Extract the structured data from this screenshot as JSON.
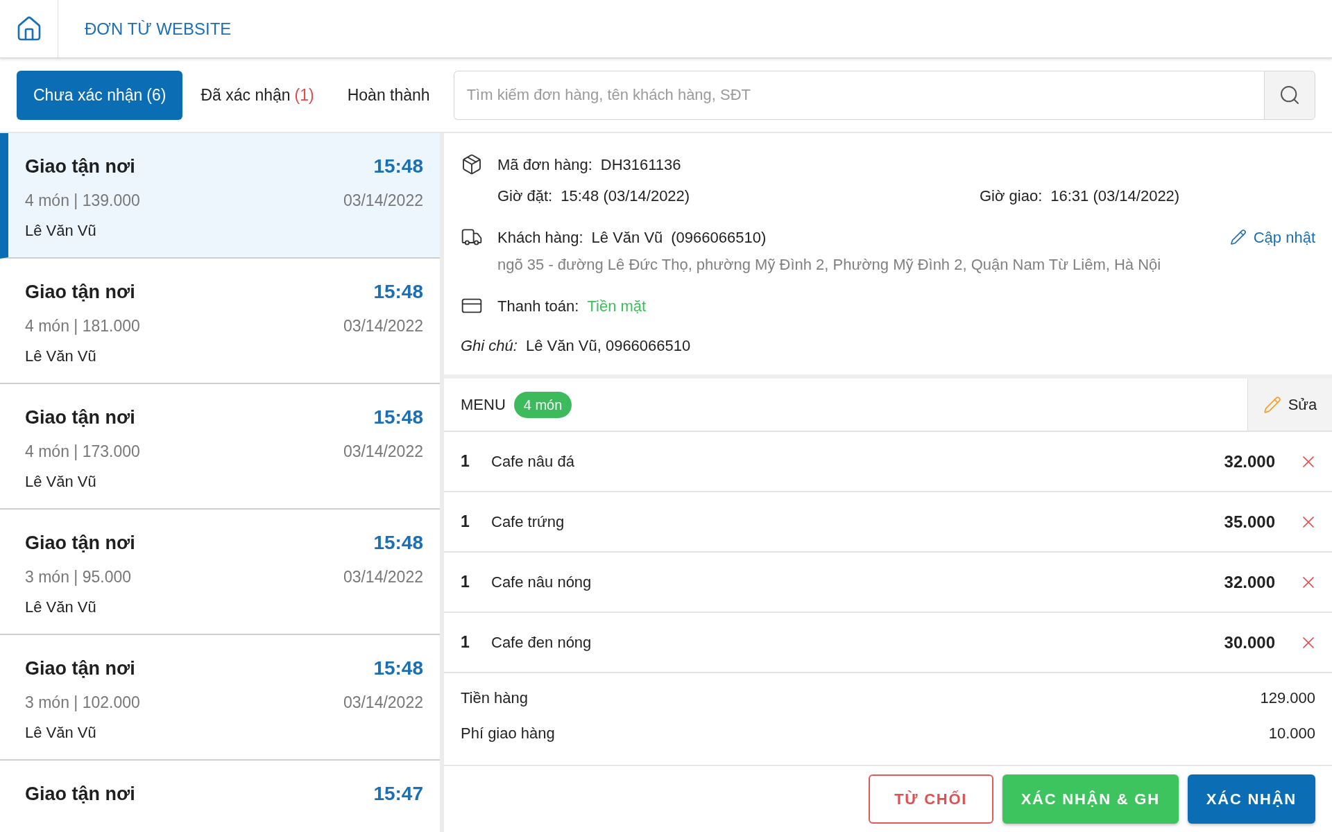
{
  "header": {
    "title": "ĐƠN TỪ WEBSITE"
  },
  "tabs": [
    {
      "label": "Chưa xác nhận",
      "count": "(6)",
      "selected": true
    },
    {
      "label": "Đã xác nhận",
      "count": "(1)",
      "selected": false
    },
    {
      "label": "Hoàn thành",
      "selected": false
    }
  ],
  "search": {
    "placeholder": "Tìm kiếm đơn hàng, tên khách hàng, SĐT"
  },
  "orders": [
    {
      "title": "Giao tận nơi",
      "time": "15:48",
      "summary": "4 món | 139.000",
      "date": "03/14/2022",
      "customer": "Lê Văn Vũ",
      "selected": true
    },
    {
      "title": "Giao tận nơi",
      "time": "15:48",
      "summary": "4 món | 181.000",
      "date": "03/14/2022",
      "customer": "Lê Văn Vũ",
      "selected": false
    },
    {
      "title": "Giao tận nơi",
      "time": "15:48",
      "summary": "4 món | 173.000",
      "date": "03/14/2022",
      "customer": "Lê Văn Vũ",
      "selected": false
    },
    {
      "title": "Giao tận nơi",
      "time": "15:48",
      "summary": "3 món | 95.000",
      "date": "03/14/2022",
      "customer": "Lê Văn Vũ",
      "selected": false
    },
    {
      "title": "Giao tận nơi",
      "time": "15:48",
      "summary": "3 món | 102.000",
      "date": "03/14/2022",
      "customer": "Lê Văn Vũ",
      "selected": false
    },
    {
      "title": "Giao tận nơi",
      "time": "15:47",
      "selected": false
    }
  ],
  "detail": {
    "order_code": {
      "label": "Mã đơn hàng:",
      "value": "DH3161136"
    },
    "order_time": {
      "label": "Giờ đặt:",
      "value": "15:48 (03/14/2022)"
    },
    "delivery_time": {
      "label": "Giờ giao:",
      "value": "16:31 (03/14/2022)"
    },
    "customer": {
      "label": "Khách hàng:",
      "name": "Lê Văn Vũ",
      "phone": "(0966066510)"
    },
    "update_link": "Cập nhật",
    "address": "ngõ 35 - đường Lê Đức Thọ, phường Mỹ Đình 2, Phường Mỹ Đình 2, Quận Nam Từ Liêm, Hà Nội",
    "payment": {
      "label": "Thanh toán:",
      "value": "Tiền mặt"
    },
    "note": {
      "label": "Ghi chú:",
      "value": "Lê Văn Vũ, 0966066510"
    }
  },
  "menu": {
    "title": "MENU",
    "badge": "4 món",
    "edit_button": "Sửa",
    "items": [
      {
        "qty": "1",
        "name": "Cafe nâu đá",
        "price": "32.000"
      },
      {
        "qty": "1",
        "name": "Cafe trứng",
        "price": "35.000"
      },
      {
        "qty": "1",
        "name": "Cafe nâu nóng",
        "price": "32.000"
      },
      {
        "qty": "1",
        "name": "Cafe đen nóng",
        "price": "30.000"
      }
    ]
  },
  "summary": [
    {
      "label": "Tiền hàng",
      "value": "129.000"
    },
    {
      "label": "Phí giao hàng",
      "value": "10.000"
    }
  ],
  "actions": [
    {
      "label": "TỪ CHỐI",
      "kind": "outline"
    },
    {
      "label": "XÁC NHẬN & GH",
      "kind": "success"
    },
    {
      "label": "XÁC NHẬN",
      "kind": "primary"
    }
  ]
}
